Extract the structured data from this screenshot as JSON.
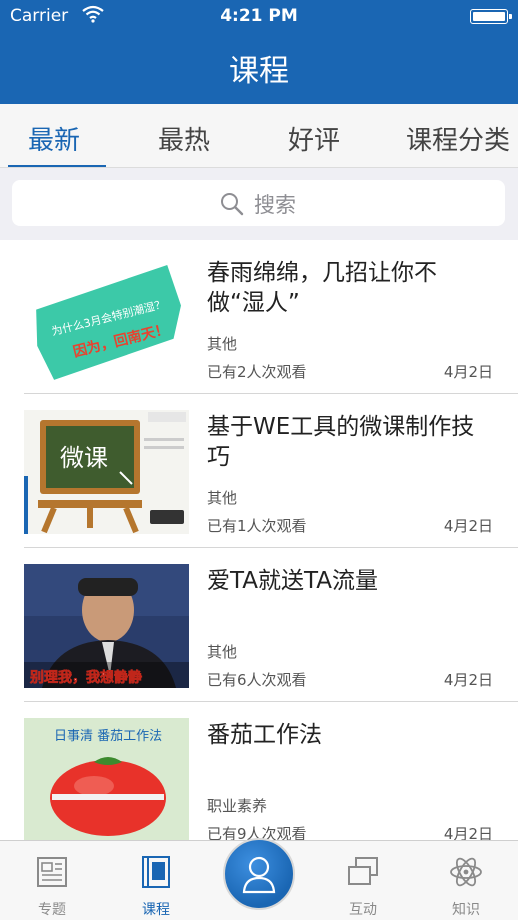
{
  "status_bar": {
    "carrier": "Carrier",
    "time": "4:21 PM"
  },
  "nav": {
    "title": "课程"
  },
  "tabs": [
    {
      "label": "最新",
      "active": true
    },
    {
      "label": "最热",
      "active": false
    },
    {
      "label": "好评",
      "active": false
    },
    {
      "label": "课程分类",
      "active": false
    }
  ],
  "search": {
    "placeholder": "搜索"
  },
  "courses": [
    {
      "title": "春雨绵绵，几招让你不做“湿人”",
      "category": "其他",
      "views": "已有2人次观看",
      "date": "4月2日",
      "thumb_text": [
        "为什么3月会特别潮湿？",
        "因为，回南天！"
      ]
    },
    {
      "title": "基于WE工具的微课制作技巧",
      "category": "其他",
      "views": "已有1人次观看",
      "date": "4月2日",
      "thumb_text": [
        "微课"
      ]
    },
    {
      "title": "爱TA就送TA流量",
      "category": "其他",
      "views": "已有6人次观看",
      "date": "4月2日",
      "thumb_text": [
        "别理我，我想静静"
      ]
    },
    {
      "title": "番茄工作法",
      "category": "职业素养",
      "views": "已有9人次观看",
      "date": "4月2日",
      "thumb_text": [
        "日事清 番茄工作法"
      ]
    }
  ],
  "tabbar": {
    "items": [
      {
        "label": "专题",
        "icon": "document-icon",
        "active": false
      },
      {
        "label": "课程",
        "icon": "book-icon",
        "active": true
      },
      {
        "label": "",
        "icon": "profile-icon",
        "active": false
      },
      {
        "label": "互动",
        "icon": "chat-icon",
        "active": false
      },
      {
        "label": "知识",
        "icon": "atom-icon",
        "active": false
      }
    ]
  },
  "colors": {
    "primary": "#1a66b3",
    "background": "#efeff4",
    "text": "#222222",
    "muted": "#555555"
  }
}
